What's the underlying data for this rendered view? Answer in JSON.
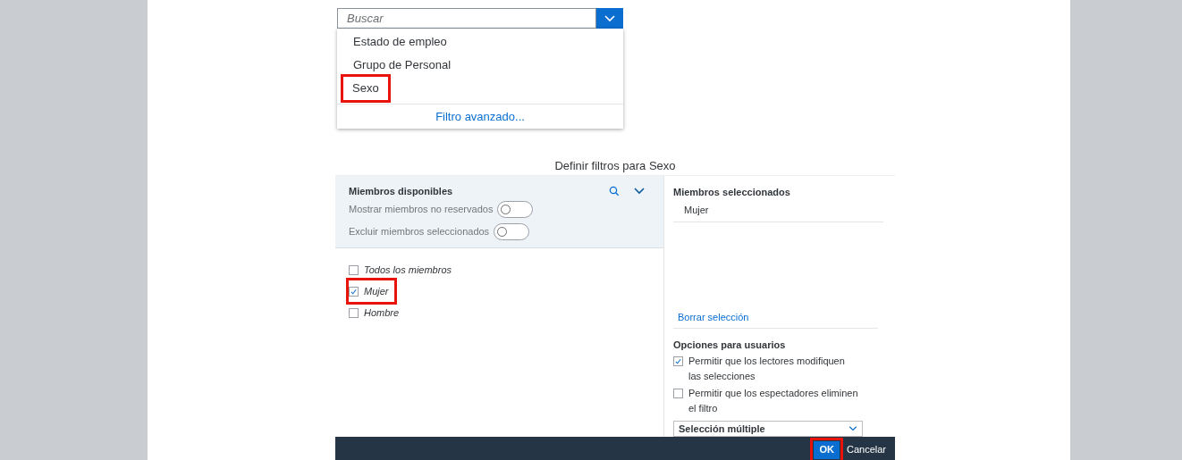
{
  "search": {
    "placeholder": "Buscar"
  },
  "menu": {
    "items": [
      {
        "label": "Estado de empleo",
        "highlighted": false
      },
      {
        "label": "Grupo de Personal",
        "highlighted": false
      },
      {
        "label": "Sexo",
        "highlighted": true
      }
    ],
    "link": "Filtro avanzado..."
  },
  "dialog": {
    "title": "Definir filtros para Sexo",
    "available": {
      "title": "Miembros disponibles",
      "toggles": [
        {
          "label": "Mostrar miembros no reservados",
          "on": false
        },
        {
          "label": "Excluir miembros seleccionados",
          "on": false
        }
      ],
      "members": [
        {
          "label": "Todos los miembros",
          "checked": false,
          "highlighted": false
        },
        {
          "label": "Mujer",
          "checked": true,
          "highlighted": true
        },
        {
          "label": "Hombre",
          "checked": false,
          "highlighted": false
        }
      ]
    },
    "selected": {
      "title": "Miembros seleccionados",
      "items": [
        "Mujer"
      ],
      "clear": "Borrar selección"
    },
    "options": {
      "title": "Opciones para usuarios",
      "checks": [
        {
          "label": "Permitir que los lectores modifiquen las selecciones",
          "checked": true
        },
        {
          "label": "Permitir que los espectadores eliminen el filtro",
          "checked": false
        }
      ],
      "mode": "Selección múltiple"
    },
    "buttons": [
      {
        "label": "OK",
        "kind": "primary",
        "highlighted": true
      },
      {
        "label": "Cancelar",
        "kind": "plain",
        "highlighted": false
      }
    ]
  }
}
